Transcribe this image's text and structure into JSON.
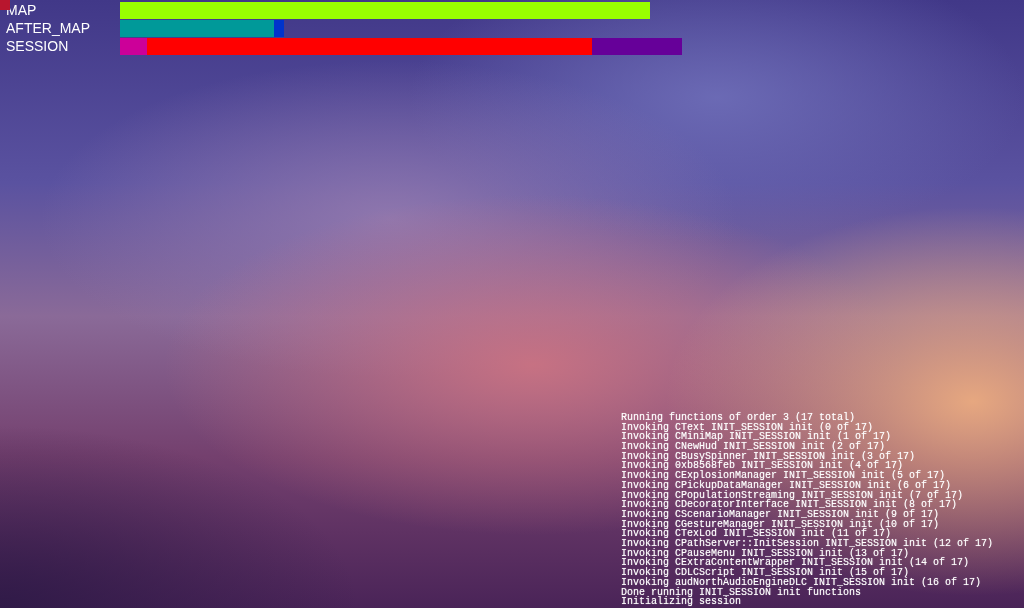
{
  "timing_bars": [
    {
      "label": "MAP"
    },
    {
      "label": "AFTER_MAP"
    },
    {
      "label": "SESSION"
    }
  ],
  "log": {
    "lines": [
      "Running functions of order 3 (17 total)",
      "Invoking CText INIT_SESSION init (0 of 17)",
      "Invoking CMiniMap INIT_SESSION init (1 of 17)",
      "Invoking CNewHud INIT_SESSION init (2 of 17)",
      "Invoking CBusySpinner INIT_SESSION init (3 of 17)",
      "Invoking 0xb8568feb INIT_SESSION init (4 of 17)",
      "Invoking CExplosionManager INIT_SESSION init (5 of 17)",
      "Invoking CPickupDataManager INIT_SESSION init (6 of 17)",
      "Invoking CPopulationStreaming INIT_SESSION init (7 of 17)",
      "Invoking CDecoratorInterface INIT_SESSION init (8 of 17)",
      "Invoking CScenarioManager INIT_SESSION init (9 of 17)",
      "Invoking CGestureManager INIT_SESSION init (10 of 17)",
      "Invoking CTexLod INIT_SESSION init (11 of 17)",
      "Invoking CPathServer::InitSession INIT_SESSION init (12 of 17)",
      "Invoking CPauseMenu INIT_SESSION init (13 of 17)",
      "Invoking CExtraContentWrapper INIT_SESSION init (14 of 17)",
      "Invoking CDLCScript INIT_SESSION init (15 of 17)",
      "Invoking audNorthAudioEngineDLC INIT_SESSION init (16 of 17)",
      "Done running INIT_SESSION init functions",
      "Initializing session"
    ]
  }
}
